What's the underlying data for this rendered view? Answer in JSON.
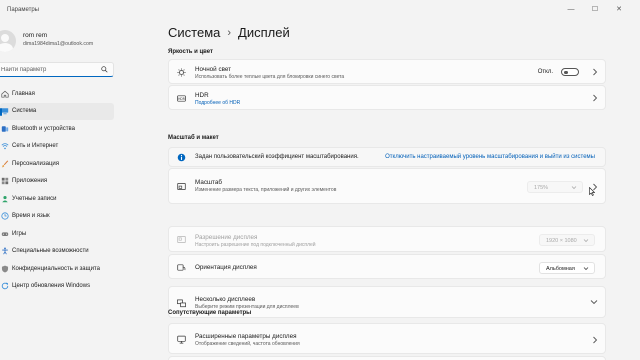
{
  "window": {
    "title": "Параметры",
    "controls": {
      "minimize": "—",
      "maximize": "☐",
      "close": "✕"
    }
  },
  "user": {
    "name": "rom rem",
    "email": "dima1984dima1@outlook.com"
  },
  "search": {
    "placeholder": "Найти параметр",
    "value": ""
  },
  "sidebar": {
    "items": [
      {
        "label": "Главная",
        "icon": "home-icon"
      },
      {
        "label": "Система",
        "icon": "system-icon",
        "selected": true
      },
      {
        "label": "Bluetooth и устройства",
        "icon": "bluetooth-icon"
      },
      {
        "label": "Сеть и Интернет",
        "icon": "network-icon"
      },
      {
        "label": "Персонализация",
        "icon": "brush-icon"
      },
      {
        "label": "Приложения",
        "icon": "apps-icon"
      },
      {
        "label": "Учетные записи",
        "icon": "accounts-icon"
      },
      {
        "label": "Время и язык",
        "icon": "time-language-icon"
      },
      {
        "label": "Игры",
        "icon": "gamepad-icon"
      },
      {
        "label": "Специальные возможности",
        "icon": "accessibility-icon"
      },
      {
        "label": "Конфиденциальность и защита",
        "icon": "shield-icon"
      },
      {
        "label": "Центр обновления Windows",
        "icon": "update-icon"
      }
    ]
  },
  "breadcrumb": {
    "parent": "Система",
    "separator": "›",
    "current": "Дисплей"
  },
  "sections": {
    "brightness": "Яркость и цвет",
    "scale": "Масштаб и макет",
    "related": "Сопутствующие параметры"
  },
  "night_light": {
    "title": "Ночной свет",
    "desc": "Использовать более теплые цвета для блокировки синего света",
    "state": "Откл.",
    "on": false
  },
  "hdr": {
    "title": "HDR",
    "link": "Подробнее об HDR"
  },
  "scale_info": {
    "text": "Задан пользовательский коэффициент масштабирования.",
    "link": "Отключить настраиваемый уровень масштабирования и выйти из системы"
  },
  "scale": {
    "title": "Масштаб",
    "desc": "Изменение размера текста, приложений и других элементов",
    "value": "175%"
  },
  "resolution": {
    "title": "Разрешение дисплея",
    "desc": "Настроить разрешение под подключенный дисплей",
    "value": "1920 × 1080"
  },
  "orientation": {
    "title": "Ориентация дисплея",
    "value": "Альбомная"
  },
  "multiple": {
    "title": "Несколько дисплеев",
    "desc": "Выберите режим презентации для дисплеев"
  },
  "advanced": {
    "title": "Расширенные параметры дисплея",
    "desc": "Отображение сведений, частота обновления"
  },
  "colors": {
    "accent": "#0067c0",
    "link": "#005fb8",
    "background": "#f3f3f3",
    "card": "#fbfbfb"
  }
}
